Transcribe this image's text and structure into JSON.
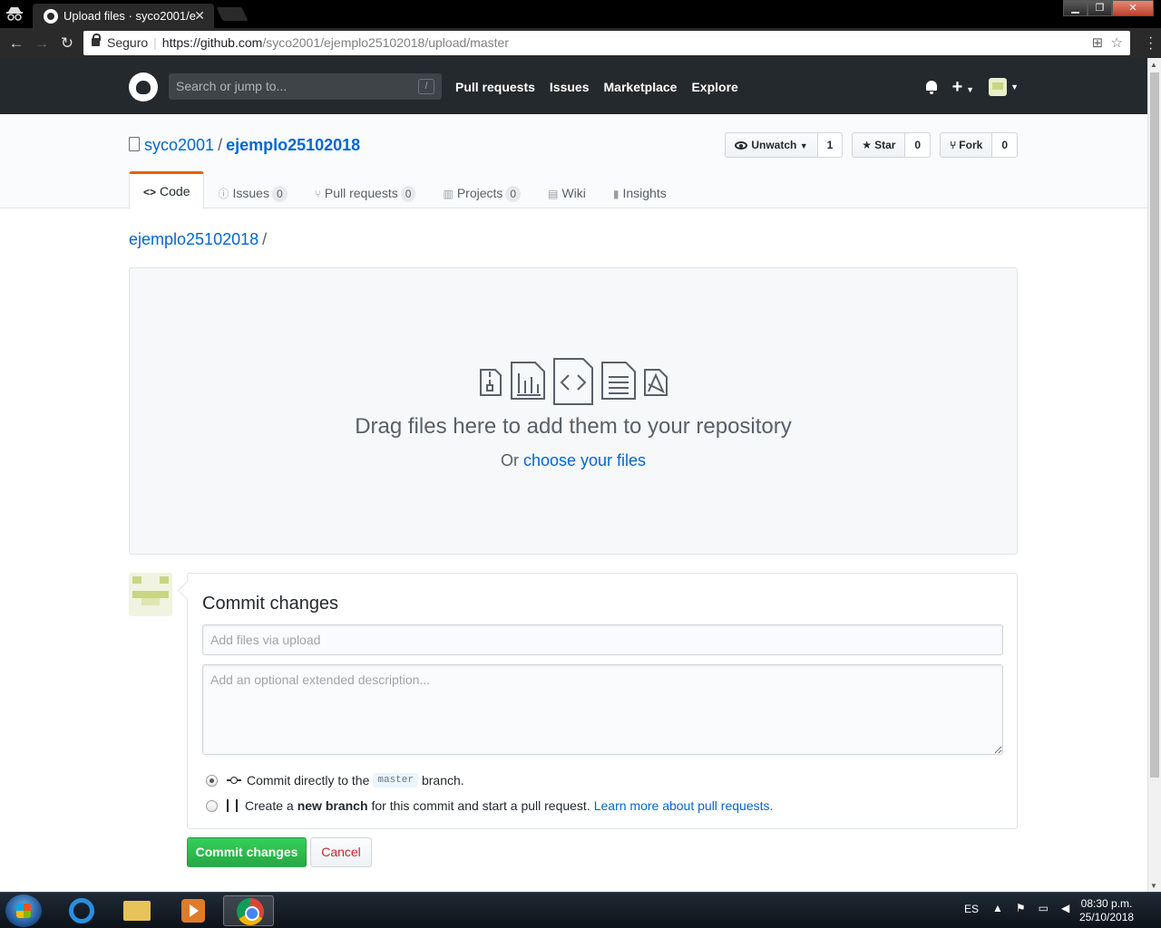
{
  "browser": {
    "tab_title": "Upload files · syco2001/e",
    "tab_close": "✕",
    "secure_label": "Seguro",
    "url_host": "https://github.com",
    "url_path": "/syco2001/ejemplo25102018/upload/master"
  },
  "gh_header": {
    "search_placeholder": "Search or jump to...",
    "search_key": "/",
    "nav": [
      "Pull requests",
      "Issues",
      "Marketplace",
      "Explore"
    ]
  },
  "repo": {
    "owner": "syco2001",
    "separator": "/",
    "name": "ejemplo25102018",
    "watch_label": "Unwatch",
    "watch_count": "1",
    "star_label": "Star",
    "star_count": "0",
    "fork_label": "Fork",
    "fork_count": "0"
  },
  "reponav": [
    {
      "label": "Code",
      "icon": "<>",
      "counter": ""
    },
    {
      "label": "Issues",
      "icon": "ⓘ",
      "counter": "0"
    },
    {
      "label": "Pull requests",
      "icon": "⑂",
      "counter": "0"
    },
    {
      "label": "Projects",
      "icon": "▥",
      "counter": "0"
    },
    {
      "label": "Wiki",
      "icon": "▤",
      "counter": ""
    },
    {
      "label": "Insights",
      "icon": "▮",
      "counter": ""
    }
  ],
  "breadcrumb": {
    "repo": "ejemplo25102018",
    "sep": "/"
  },
  "upload": {
    "title": "Drag files here to add them to your repository",
    "or": "Or",
    "choose": "choose your files"
  },
  "commit": {
    "heading": "Commit changes",
    "summary_placeholder": "Add files via upload",
    "description_placeholder": "Add an optional extended description...",
    "direct_prefix": "Commit directly to the",
    "direct_branch": "master",
    "direct_suffix": "branch.",
    "new_prefix": "Create a",
    "new_bold": "new branch",
    "new_suffix": "for this commit and start a pull request.",
    "new_link": "Learn more about pull requests.",
    "submit_label": "Commit changes",
    "cancel_label": "Cancel"
  },
  "taskbar": {
    "language": "ES",
    "time": "08:30 p.m.",
    "date": "25/10/2018"
  }
}
